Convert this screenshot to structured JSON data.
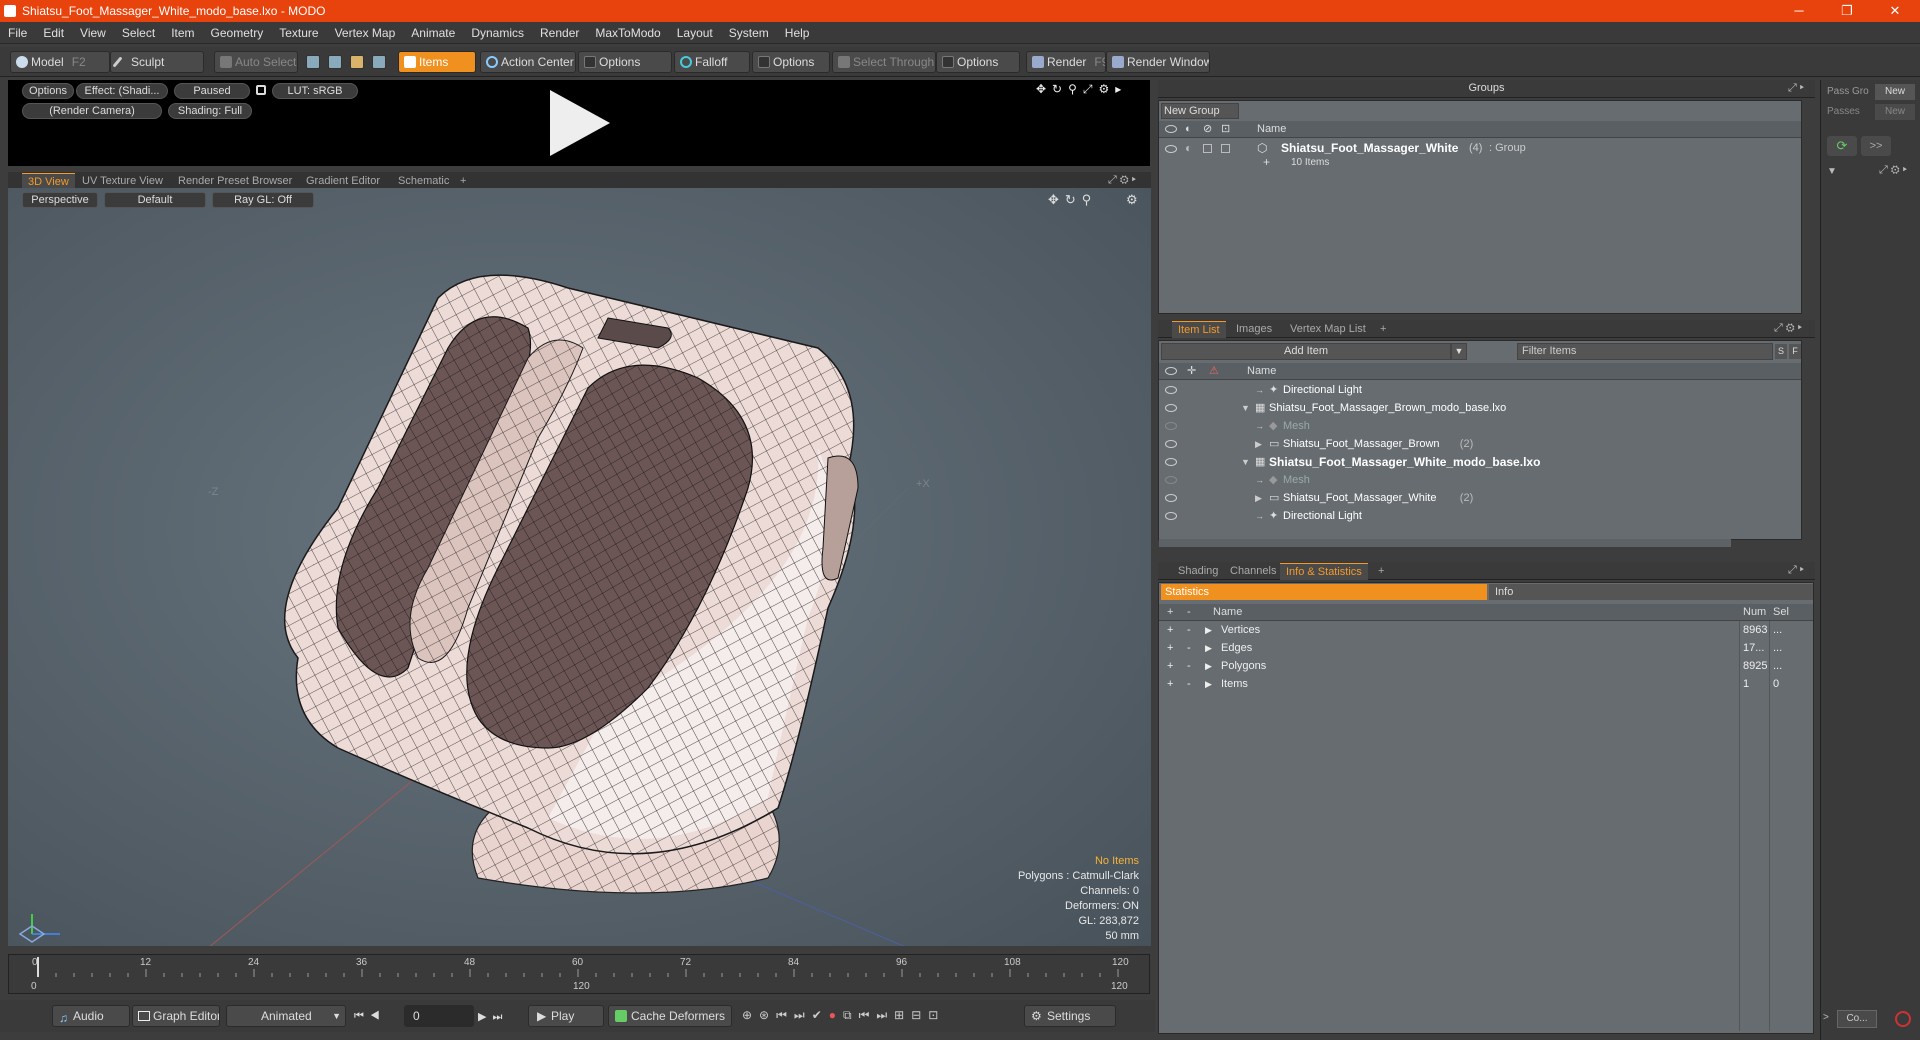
{
  "window": {
    "title": "Shiatsu_Foot_Massager_White_modo_base.lxo - MODO",
    "minimize": "─",
    "maximize": "❐",
    "close": "✕"
  },
  "menu": [
    "File",
    "Edit",
    "View",
    "Select",
    "Item",
    "Geometry",
    "Texture",
    "Vertex Map",
    "Animate",
    "Dynamics",
    "Render",
    "MaxToModo",
    "Layout",
    "System",
    "Help"
  ],
  "toolbar": {
    "model": "Model",
    "model_key": "F2",
    "sculpt": "Sculpt",
    "auto_select": "Auto Select",
    "items": "Items",
    "action_center": "Action Center",
    "options1": "Options",
    "falloff": "Falloff",
    "options2": "Options",
    "select_through": "Select Through",
    "options3": "Options",
    "render": "Render",
    "render_key": "F9",
    "render_window": "Render Window"
  },
  "preview": {
    "options": "Options",
    "effect": "Effect: (Shadi...",
    "paused": "Paused",
    "lut": "LUT: sRGB",
    "camera": "(Render Camera)",
    "shading": "Shading: Full"
  },
  "view_tabs": [
    "3D View",
    "UV Texture View",
    "Render Preset Browser",
    "Gradient Editor",
    "Schematic",
    "+"
  ],
  "viewport": {
    "perspective": "Perspective",
    "default": "Default",
    "raygl": "Ray GL: Off",
    "axis_neg_z": "-Z",
    "axis_pos_x": "+X",
    "info": {
      "no_items": "No Items",
      "polygons": "Polygons : Catmull-Clark",
      "channels": "Channels: 0",
      "deformers": "Deformers: ON",
      "gl": "GL: 283,872",
      "mm": "50 mm"
    }
  },
  "groups": {
    "title": "Groups",
    "new_group": "New Group",
    "col_name": "Name",
    "item_name": "Shiatsu_Foot_Massager_White",
    "item_count": "(4)",
    "item_type": ": Group",
    "item_sub": "10 Items"
  },
  "item_list": {
    "tabs": [
      "Item List",
      "Images",
      "Vertex Map List",
      "+"
    ],
    "add_item": "Add Item",
    "filter": "Filter Items",
    "s": "S",
    "f": "F",
    "col_name": "Name",
    "rows": [
      {
        "label": "Directional Light",
        "indent": 1,
        "bold": false,
        "dim": false,
        "icon": "light"
      },
      {
        "label": "Shiatsu_Foot_Massager_Brown_modo_base.lxo",
        "indent": 0,
        "bold": false,
        "dim": false,
        "icon": "scene"
      },
      {
        "label": "Mesh",
        "indent": 1,
        "bold": false,
        "dim": true,
        "icon": "mesh"
      },
      {
        "label": "Shiatsu_Foot_Massager_Brown",
        "count": "(2)",
        "indent": 1,
        "bold": false,
        "dim": false,
        "icon": "group"
      },
      {
        "label": "Shiatsu_Foot_Massager_White_modo_base.lxo",
        "indent": 0,
        "bold": true,
        "dim": false,
        "icon": "scene"
      },
      {
        "label": "Mesh",
        "indent": 1,
        "bold": false,
        "dim": true,
        "icon": "mesh"
      },
      {
        "label": "Shiatsu_Foot_Massager_White",
        "count": "(2)",
        "indent": 1,
        "bold": false,
        "dim": false,
        "icon": "group"
      },
      {
        "label": "Directional Light",
        "indent": 1,
        "bold": false,
        "dim": false,
        "icon": "light"
      }
    ]
  },
  "stats": {
    "tabs": [
      "Shading",
      "Channels",
      "Info & Statistics",
      "+"
    ],
    "statistics": "Statistics",
    "info": "Info",
    "col_name": "Name",
    "col_num": "Num",
    "col_sel": "Sel",
    "rows": [
      {
        "name": "Vertices",
        "num": "8963",
        "sel": "..."
      },
      {
        "name": "Edges",
        "num": "17...",
        "sel": "..."
      },
      {
        "name": "Polygons",
        "num": "8925",
        "sel": "..."
      },
      {
        "name": "Items",
        "num": "1",
        "sel": "0"
      }
    ]
  },
  "far_right": {
    "pass_group": "Pass Gro",
    "passes": "Passes",
    "new1": "New",
    "new2": "New",
    "arrows": ">>",
    "co": "Co..."
  },
  "timeline": {
    "ticks": [
      "0",
      "12",
      "24",
      "36",
      "48",
      "60",
      "72",
      "84",
      "96",
      "108",
      "120"
    ],
    "start": "0",
    "mid": "120",
    "end": "120"
  },
  "bottom": {
    "audio": "Audio",
    "graph_editor": "Graph Editor",
    "animated": "Animated",
    "frame": "0",
    "play": "Play",
    "cache": "Cache Deformers",
    "settings": "Settings"
  }
}
